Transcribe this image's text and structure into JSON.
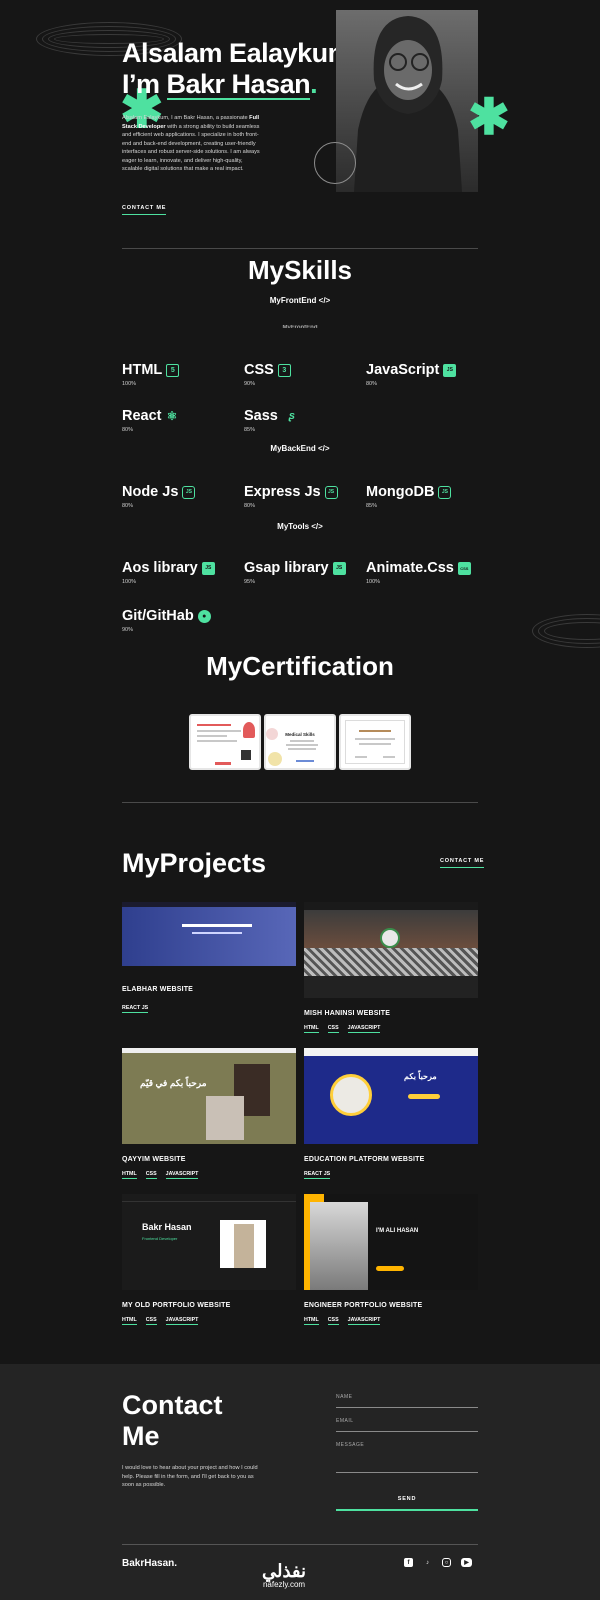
{
  "hero": {
    "greeting": "Alsalam Ealaykum",
    "intro_prefix": "I’m ",
    "name": "Bakr Hasan",
    "dot": ".",
    "desc_pre": "Alsalam Ealaykum, I am Bakr Hasan, a passionate ",
    "desc_role": "Full Stack Developer",
    "desc_post": " with a strong ability to build seamless and efficient web applications. I specialize in both front-end and back-end development, creating user-friendly interfaces and robust server-side solutions. I am always eager to learn, innovate, and deliver high-quality, scalable digital solutions that make a real impact.",
    "cta": "CONTACT ME"
  },
  "skills": {
    "title": "MySkills",
    "frontend_label": "MyFrontEnd </>",
    "frontend_ghost": "MyFrontEnd",
    "backend_label": "MyBackEnd </>",
    "tools_label": "MyTools </>",
    "frontend": [
      {
        "name": "HTML",
        "pct": "100%",
        "icon": "html5-icon"
      },
      {
        "name": "CSS",
        "pct": "90%",
        "icon": "css3-icon"
      },
      {
        "name": "JavaScript",
        "pct": "80%",
        "icon": "js-icon"
      },
      {
        "name": "React",
        "pct": "80%",
        "icon": "react-icon"
      },
      {
        "name": "Sass",
        "pct": "85%",
        "icon": "sass-icon"
      }
    ],
    "backend": [
      {
        "name": "Node Js",
        "pct": "80%",
        "icon": "nodejs-icon"
      },
      {
        "name": "Express Js",
        "pct": "80%",
        "icon": "nodejs-icon"
      },
      {
        "name": "MongoDB",
        "pct": "85%",
        "icon": "nodejs-icon"
      }
    ],
    "tools": [
      {
        "name": "Aos library",
        "pct": "100%",
        "icon": "js-icon"
      },
      {
        "name": "Gsap library",
        "pct": "95%",
        "icon": "js-icon"
      },
      {
        "name": "Animate.Css",
        "pct": "100%",
        "icon": "css-box-icon"
      },
      {
        "name": "Git/GitHab",
        "pct": "90%",
        "icon": "github-icon"
      }
    ],
    "icon_text": {
      "js": "JS",
      "css": "CSS"
    }
  },
  "certification": {
    "title": "MyCertification",
    "c2_heading": "Medical Skills"
  },
  "projects": {
    "title": "MyProjects",
    "cta": "CONTACT ME",
    "items": [
      {
        "title": "ELABHAR WEBSITE",
        "tags": [
          "REACT JS"
        ]
      },
      {
        "title": "MISH HANINSI WEBSITE",
        "tags": [
          "HTML",
          "CSS",
          "JAVASCRIPT"
        ]
      },
      {
        "title": "QAYYIM WEBSITE",
        "tags": [
          "HTML",
          "CSS",
          "JAVASCRIPT"
        ]
      },
      {
        "title": "EDUCATION PLATFORM WEBSITE",
        "tags": [
          "REACT JS"
        ]
      },
      {
        "title": "MY OLD PORTFOLIO WEBSITE",
        "tags": [
          "HTML",
          "CSS",
          "JAVASCRIPT"
        ]
      },
      {
        "title": "ENGINEER PORTFOLIO WEBSITE",
        "tags": [
          "HTML",
          "CSS",
          "JAVASCRIPT"
        ]
      }
    ],
    "thumb_text": {
      "qayyim": "مرحباً بكم في قيّم",
      "edu": "مرحباً بكم",
      "old_name": "Bakr Hasan",
      "old_role": "Frontend Developer",
      "eng_name": "I'M ALI HASAN"
    }
  },
  "contact": {
    "title_line1": "Contact",
    "title_line2": "Me",
    "desc": "I would love to hear about your project and how I could help. Please fill in the form, and I'll get back to you as soon as possible.",
    "name_placeholder": "NAME",
    "email_placeholder": "EMAIL",
    "message_placeholder": "MESSAGE",
    "send": "SEND"
  },
  "footer": {
    "brand": "BakrHasan.",
    "watermark_ar": "نفذلي",
    "watermark_lt": "nafezly.com"
  },
  "colors": {
    "accent": "#4ee1a0",
    "bg": "#161616",
    "contact_bg": "#242424"
  }
}
